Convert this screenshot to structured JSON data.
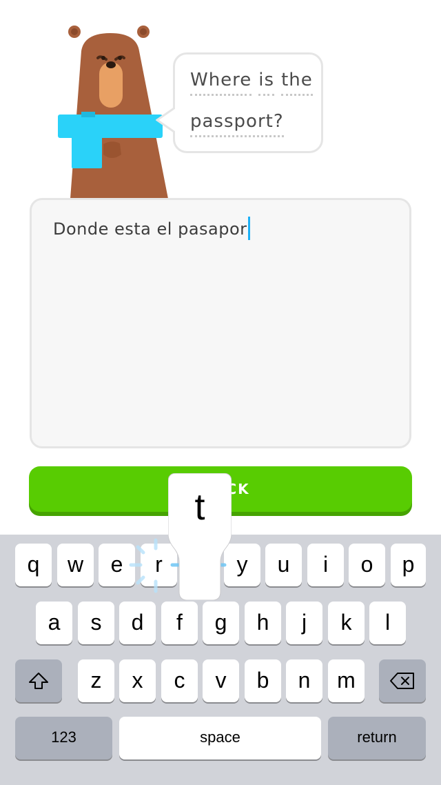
{
  "prompt": {
    "words": [
      "Where",
      "is",
      "the",
      "passport?"
    ]
  },
  "answer": {
    "value": "Donde esta el pasapor"
  },
  "check_button": {
    "label": "CHECK",
    "visible_label": "CK"
  },
  "key_popup": {
    "letter": "t"
  },
  "keyboard": {
    "row1": [
      "q",
      "w",
      "e",
      "r",
      "t",
      "y",
      "u",
      "i",
      "o",
      "p"
    ],
    "row2": [
      "a",
      "s",
      "d",
      "f",
      "g",
      "h",
      "j",
      "k",
      "l"
    ],
    "row3": [
      "z",
      "x",
      "c",
      "v",
      "b",
      "n",
      "m"
    ],
    "numbers_label": "123",
    "space_label": "space",
    "return_label": "return"
  },
  "colors": {
    "accent": "#58cc02",
    "caret": "#1cb0f6",
    "character_scarf": "#2ad2f9",
    "character_fur": "#a8603c"
  },
  "icons": {
    "shift": "shift-icon",
    "delete": "backspace-icon"
  }
}
